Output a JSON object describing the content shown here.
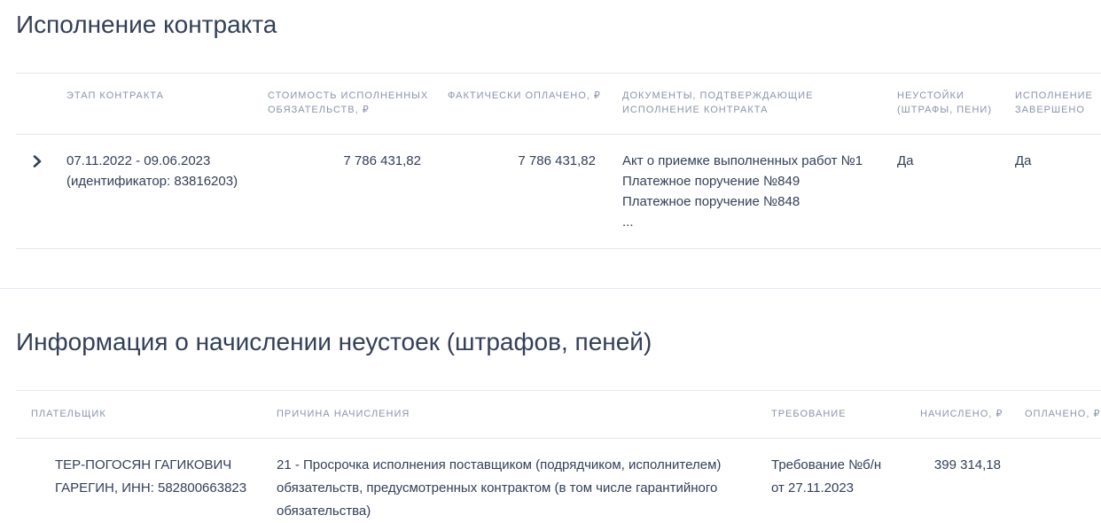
{
  "execution": {
    "title": "Исполнение контракта",
    "headers": {
      "stage": "ЭТАП КОНТРАКТА",
      "cost": [
        "СТОИМОСТЬ ИСПОЛНЕННЫХ",
        "ОБЯЗАТЕЛЬСТВ, ₽"
      ],
      "paid": "ФАКТИЧЕСКИ ОПЛАЧЕНО, ₽",
      "docs": [
        "ДОКУМЕНТЫ, ПОДТВЕРЖДАЮЩИЕ",
        "ИСПОЛНЕНИЕ КОНТРАКТА"
      ],
      "penalties": [
        "НЕУСТОЙКИ",
        "(ШТРАФЫ, ПЕНИ)"
      ],
      "completed": [
        "ИСПОЛНЕНИЕ",
        "ЗАВЕРШЕНО"
      ]
    },
    "rows": [
      {
        "expand_icon": "chevron-right-icon",
        "stage": [
          "07.11.2022 - 09.06.2023",
          "(идентификатор: 83816203)"
        ],
        "cost": "7 786 431,82",
        "paid": "7 786 431,82",
        "docs": [
          "Акт о приемке выполненных работ №1",
          "Платежное поручение №849",
          "Платежное поручение №848",
          "..."
        ],
        "penalties": "Да",
        "completed": "Да"
      }
    ]
  },
  "penalties_info": {
    "title": "Информация о начислении неустоек (штрафов, пеней)",
    "headers": {
      "payer": "ПЛАТЕЛЬЩИК",
      "reason": "ПРИЧИНА НАЧИСЛЕНИЯ",
      "demand": "ТРЕБОВАНИЕ",
      "charged": "НАЧИСЛЕНО, ₽",
      "paid": "ОПЛАЧЕНО, ₽"
    },
    "rows": [
      {
        "payer": [
          "ТЕР-ПОГОСЯН ГАГИКОВИЧ",
          "ГАРЕГИН, ИНН: 582800663823"
        ],
        "reason": [
          "21 - Просрочка исполнения поставщиком (подрядчиком, исполнителем)",
          "обязательств, предусмотренных контрактом (в том числе гарантийного",
          "обязательства)"
        ],
        "demand": [
          "Требование №б/н",
          "от 27.11.2023"
        ],
        "charged": "399 314,18",
        "paid": ""
      }
    ]
  }
}
